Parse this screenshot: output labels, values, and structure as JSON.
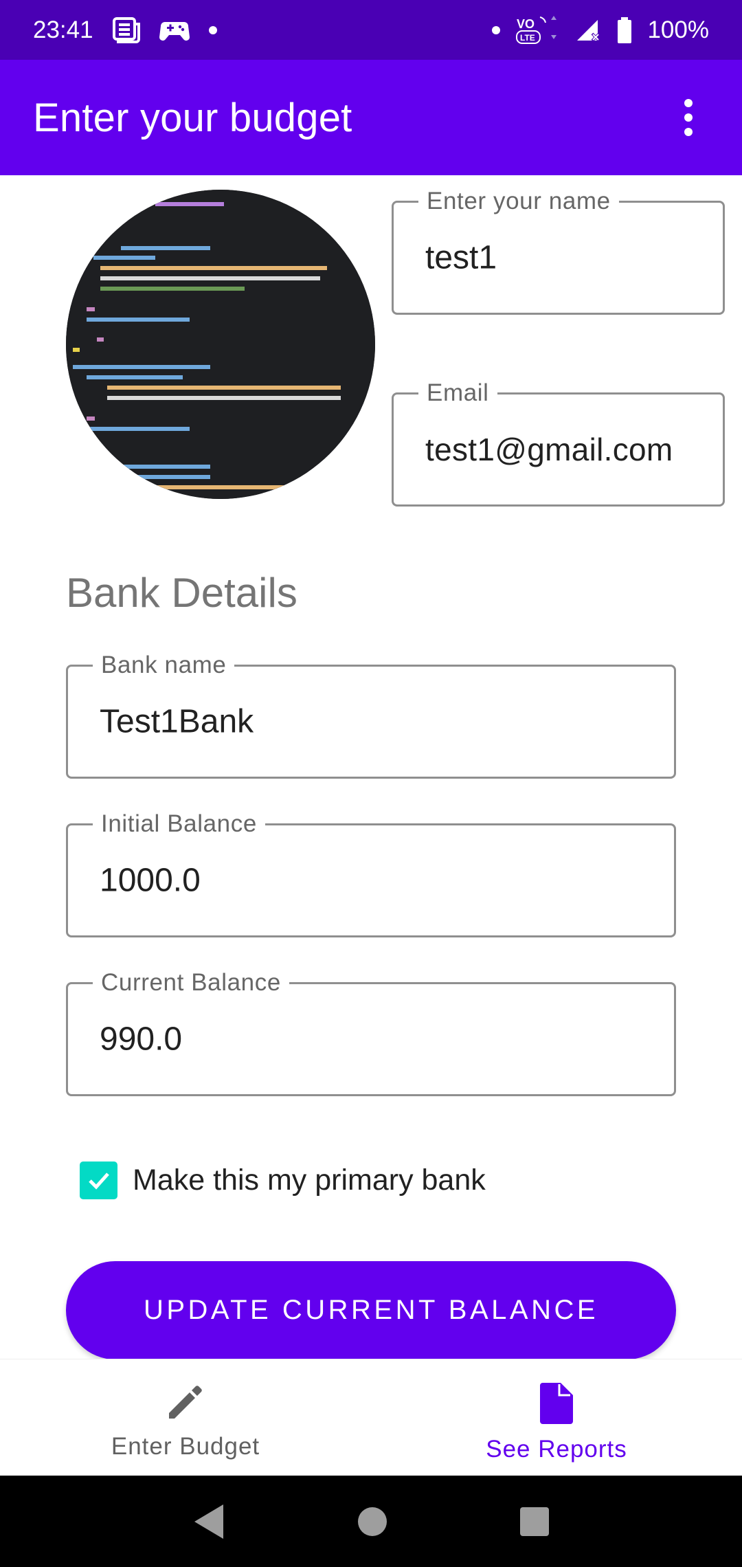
{
  "status_bar": {
    "time": "23:41",
    "battery": "100%",
    "left_icons": [
      "news-icon",
      "game-controller-icon",
      "dot-icon"
    ],
    "right_icons": [
      "dot-icon",
      "volte-icon",
      "signal-icon",
      "battery-icon"
    ]
  },
  "app_bar": {
    "title": "Enter your budget",
    "overflow_icon": "more-vert-icon"
  },
  "profile": {
    "name_label": "Enter your name",
    "name_value": "test1",
    "email_label": "Email",
    "email_value": "test1@gmail.com"
  },
  "bank_details": {
    "section_title": "Bank Details",
    "bank_name_label": "Bank name",
    "bank_name_value": "Test1Bank",
    "initial_balance_label": "Initial Balance",
    "initial_balance_value": "1000.0",
    "current_balance_label": "Current Balance",
    "current_balance_value": "990.0",
    "primary_checkbox_label": "Make this my primary bank",
    "primary_checked": true
  },
  "actions": {
    "update_button": "UPDATE CURRENT BALANCE"
  },
  "bottom_nav": {
    "items": [
      {
        "label": "Enter Budget",
        "icon": "pencil-icon",
        "active": false
      },
      {
        "label": "See Reports",
        "icon": "document-icon",
        "active": true
      }
    ]
  },
  "colors": {
    "status_bar": "#4A00B4",
    "primary": "#6200EE",
    "accent": "#03DAC5"
  }
}
